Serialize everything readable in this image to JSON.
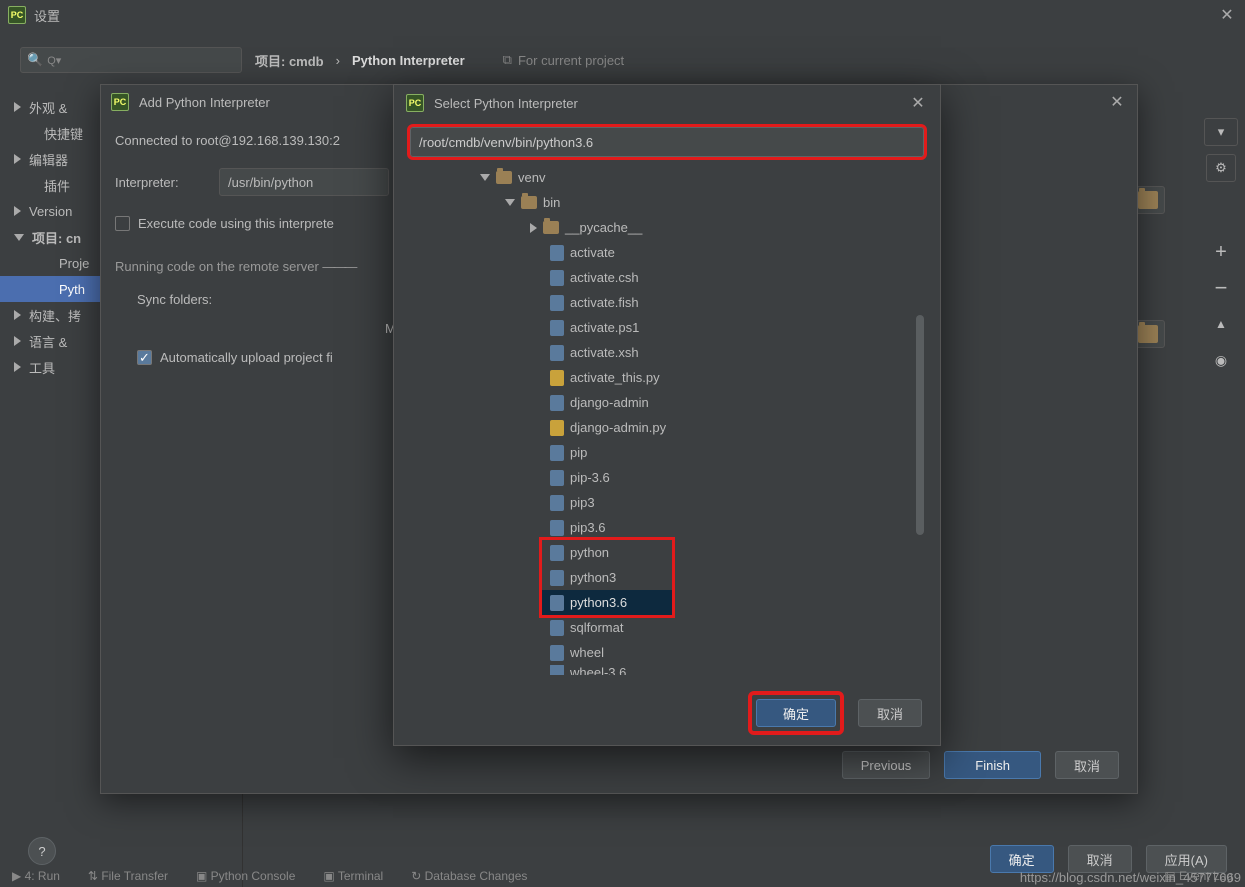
{
  "window": {
    "title": "设置"
  },
  "search": {
    "placeholder": "Q▾"
  },
  "breadcrumb": {
    "project": "项目: cmdb",
    "sep": "›",
    "page": "Python Interpreter",
    "forcurrent": "For current project"
  },
  "sidebar": {
    "items": [
      {
        "label": "外观 &",
        "expandable": true,
        "child": false
      },
      {
        "label": "快捷键",
        "expandable": false,
        "child": true,
        "plain": true
      },
      {
        "label": "编辑器",
        "expandable": true,
        "child": false
      },
      {
        "label": "插件",
        "expandable": false,
        "child": true,
        "plain": true
      },
      {
        "label": "Version",
        "expandable": true,
        "child": false
      },
      {
        "label": "项目: cn",
        "expandable": true,
        "child": false,
        "open": true,
        "bold": true
      },
      {
        "label": "Proje",
        "expandable": false,
        "child": true
      },
      {
        "label": "Pyth",
        "expandable": false,
        "child": true,
        "selected": true
      },
      {
        "label": "构建、拷",
        "expandable": true,
        "child": false
      },
      {
        "label": "语言 &",
        "expandable": true,
        "child": false
      },
      {
        "label": "工具",
        "expandable": true,
        "child": false
      }
    ]
  },
  "rightstrip": {
    "gear": "⚙",
    "plus": "+",
    "minus": "−",
    "up": "▲",
    "eye": "◉"
  },
  "footer": {
    "ok": "确定",
    "cancel": "取消",
    "apply": "应用(A)"
  },
  "help": "?",
  "addDlg": {
    "title": "Add Python Interpreter",
    "connected": "Connected to root@192.168.139.130:2",
    "interpLabel": "Interpreter:",
    "interpValue": "/usr/bin/python",
    "execChk": "Execute code using this interprete",
    "runRemote": "Running code on the remote server",
    "syncLabel": "Sync folders:",
    "m": "M",
    "autoUpload": "Automatically upload project fi",
    "autoUploadChecked": "✓",
    "prev": "Previous",
    "finish": "Finish",
    "cancel": "取消"
  },
  "selDlg": {
    "title": "Select Python Interpreter",
    "path": "/root/cmdb/venv/bin/python3.6",
    "ok": "确定",
    "cancel": "取消",
    "tree": [
      {
        "lvl": 0,
        "kind": "folder",
        "expand": "down",
        "label": "venv"
      },
      {
        "lvl": 1,
        "kind": "folder",
        "expand": "down",
        "label": "bin"
      },
      {
        "lvl": 2,
        "kind": "folder",
        "expand": "right",
        "label": "__pycache__"
      },
      {
        "lvl": 3,
        "kind": "file",
        "label": "activate"
      },
      {
        "lvl": 3,
        "kind": "file",
        "label": "activate.csh"
      },
      {
        "lvl": 3,
        "kind": "file",
        "label": "activate.fish"
      },
      {
        "lvl": 3,
        "kind": "file",
        "label": "activate.ps1"
      },
      {
        "lvl": 3,
        "kind": "file",
        "label": "activate.xsh"
      },
      {
        "lvl": 3,
        "kind": "py",
        "label": "activate_this.py"
      },
      {
        "lvl": 3,
        "kind": "file",
        "label": "django-admin"
      },
      {
        "lvl": 3,
        "kind": "py",
        "label": "django-admin.py"
      },
      {
        "lvl": 3,
        "kind": "file",
        "label": "pip"
      },
      {
        "lvl": 3,
        "kind": "file",
        "label": "pip-3.6"
      },
      {
        "lvl": 3,
        "kind": "file",
        "label": "pip3"
      },
      {
        "lvl": 3,
        "kind": "file",
        "label": "pip3.6"
      },
      {
        "lvl": 3,
        "kind": "file",
        "label": "python",
        "redstart": true
      },
      {
        "lvl": 3,
        "kind": "file",
        "label": "python3"
      },
      {
        "lvl": 3,
        "kind": "file",
        "label": "python3.6",
        "selected": true,
        "redend": true
      },
      {
        "lvl": 3,
        "kind": "file",
        "label": "sqlformat"
      },
      {
        "lvl": 3,
        "kind": "file",
        "label": "wheel"
      },
      {
        "lvl": 3,
        "kind": "file",
        "label": "wheel-3.6",
        "cut": true
      }
    ]
  },
  "tooltabs": {
    "run": "4: Run",
    "ft": "File Transfer",
    "pc": "Python Console",
    "term": "Terminal",
    "db": "Database Changes",
    "evt": "Event Log"
  },
  "watermark": "https://blog.csdn.net/weixin_45777669"
}
